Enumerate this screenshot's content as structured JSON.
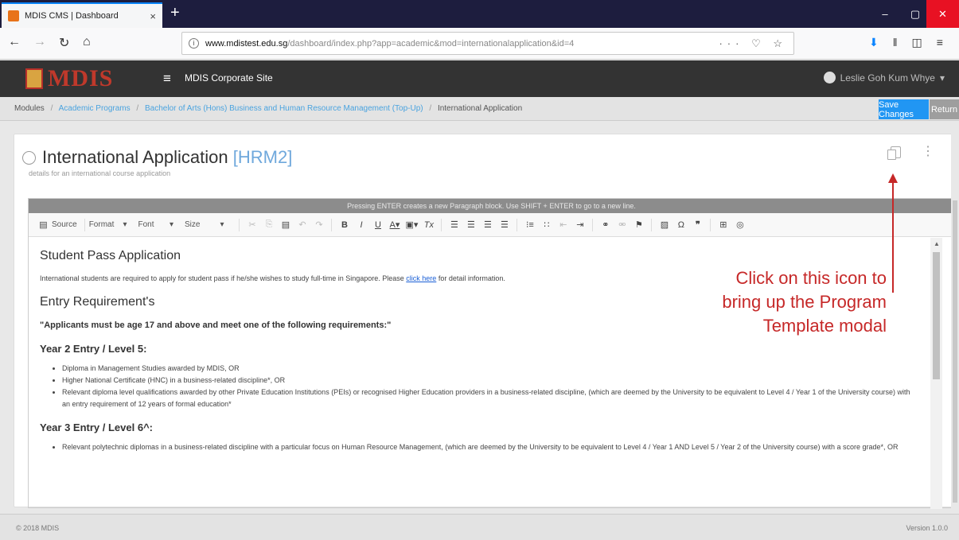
{
  "browser": {
    "tab_title": "MDIS CMS | Dashboard",
    "tab_close": "×",
    "new_tab": "+",
    "url_domain": "www.mdistest.edu.sg",
    "url_path": "/dashboard/index.php?app=academic&mod=internationalapplication&id=4",
    "url_actions": "··· ♡ ☆",
    "window_min": "–",
    "window_max": "▢",
    "window_close": "✕"
  },
  "app": {
    "logo_text": "MDIS",
    "menu_glyph": "≡",
    "site_name": "MDIS Corporate Site",
    "user_name": "Leslie Goh Kum Whye"
  },
  "breadcrumb": {
    "root": "Modules",
    "items": [
      "Academic Programs",
      "Bachelor of Arts (Hons) Business and Human Resource Management (Top-Up)",
      "International Application"
    ]
  },
  "actions": {
    "save_label": "Save Changes",
    "return_label": "Return"
  },
  "page": {
    "title": "International Application",
    "code": "[HRM2]",
    "subtitle": "details for an international course application"
  },
  "editor": {
    "notice": "Pressing ENTER creates a new Paragraph block. Use SHIFT + ENTER to go to a new line.",
    "toolbar": {
      "source": "Source",
      "format": "Format",
      "font": "Font",
      "size": "Size"
    },
    "content": {
      "h1": "Student Pass Application",
      "p1_text": "International students are required to apply for student pass if he/she wishes to study full-time in Singapore. Please",
      "p1_link": "click here",
      "p1_end": "for detail information.",
      "h2": "Entry Requirement's",
      "requirement_note": "\"Applicants must be age 17 and above and meet one of the following requirements:\"",
      "year2_heading": "Year 2 Entry / Level 5:",
      "year2_items": [
        "Diploma in Management Studies awarded by MDIS, OR",
        "Higher National Certificate (HNC) in a business-related discipline*, OR",
        "Relevant diploma level qualifications awarded by other Private Education Institutions (PEIs) or recognised Higher Education providers in a business-related discipline, (which are deemed by the University to be equivalent to Level 4 / Year 1 of the University course) with an entry requirement of 12 years of formal education*"
      ],
      "year3_heading": "Year 3 Entry / Level 6^:",
      "year3_items": [
        "Relevant polytechnic diplomas in a business-related discipline with a particular focus on Human Resource Management, (which are deemed by the University to be equivalent to Level 4 / Year 1 AND Level 5 / Year 2 of the University course) with a score grade*, OR"
      ]
    }
  },
  "annotation": {
    "line1": "Click on this icon to",
    "line2": "bring up the Program",
    "line3": "Template modal",
    "color": "#c62828"
  },
  "footer": {
    "copyright": "© 2018 MDIS",
    "version": "Version 1.0.0"
  }
}
